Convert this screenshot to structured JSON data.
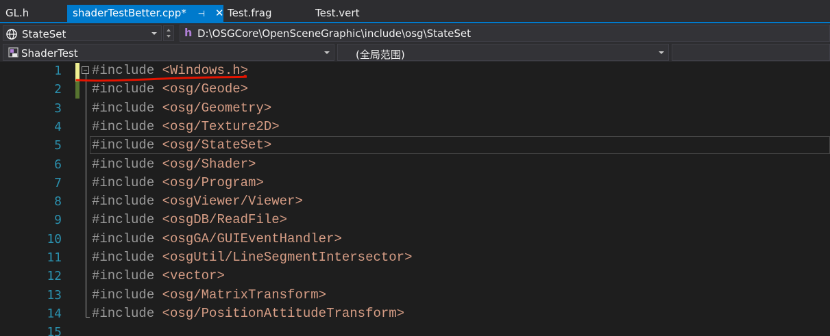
{
  "tabs": [
    {
      "label": "GL.h",
      "active": false
    },
    {
      "label": "shaderTestBetter.cpp*",
      "active": true
    },
    {
      "label": "Test.frag",
      "active": false
    },
    {
      "label": "Test.vert",
      "active": false
    }
  ],
  "tab_icons": {
    "pin": "pin-icon",
    "close": "close-icon"
  },
  "nav": {
    "project_combo": "StateSet",
    "file_path": "D:\\OSGCore\\OpenSceneGraphic\\include\\osg\\StateSet",
    "scope_combo": "ShaderTest",
    "member_combo": "(全局范围)",
    "extra_combo": ""
  },
  "editor": {
    "line_numbers": [
      "1",
      "2",
      "3",
      "4",
      "5",
      "6",
      "7",
      "8",
      "9",
      "10",
      "11",
      "12",
      "13",
      "14",
      "15"
    ],
    "lines": [
      {
        "directive": "#include",
        "target": "<Windows.h>"
      },
      {
        "directive": "#include",
        "target": "<osg/Geode>"
      },
      {
        "directive": "#include",
        "target": "<osg/Geometry>"
      },
      {
        "directive": "#include",
        "target": "<osg/Texture2D>"
      },
      {
        "directive": "#include",
        "target": "<osg/StateSet>"
      },
      {
        "directive": "#include",
        "target": "<osg/Shader>"
      },
      {
        "directive": "#include",
        "target": "<osg/Program>"
      },
      {
        "directive": "#include",
        "target": "<osgViewer/Viewer>"
      },
      {
        "directive": "#include",
        "target": "<osgDB/ReadFile>"
      },
      {
        "directive": "#include",
        "target": "<osgGA/GUIEventHandler>"
      },
      {
        "directive": "#include",
        "target": "<osgUtil/LineSegmentIntersector>"
      },
      {
        "directive": "#include",
        "target": "<vector>"
      },
      {
        "directive": "#include",
        "target": "<osg/MatrixTransform>"
      },
      {
        "directive": "#include",
        "target": "<osg/PositionAttitudeTransform>"
      }
    ]
  },
  "colors": {
    "accent": "#007acc",
    "line_number": "#2b91af",
    "include_string": "#d69d85",
    "directive": "#9b9b9b",
    "annotation_red": "#e51400",
    "unsaved_change": "#efef91",
    "saved_change": "#577430"
  }
}
